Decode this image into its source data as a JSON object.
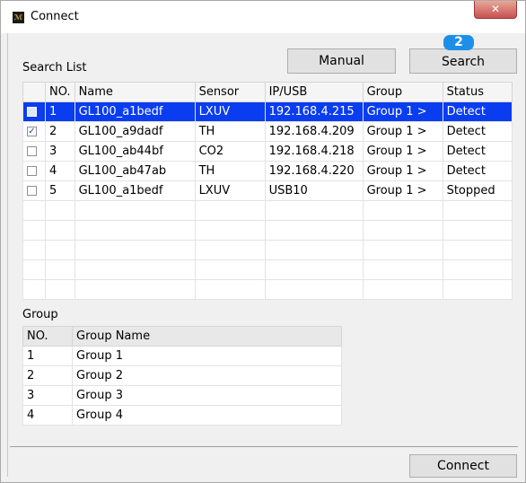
{
  "window": {
    "title": "Connect",
    "icon": "app-logo-icon",
    "close_glyph": "✕"
  },
  "buttons": {
    "manual": "Manual",
    "search": "Search",
    "connect": "Connect"
  },
  "badge": "2",
  "search_list": {
    "label": "Search List",
    "columns": [
      "",
      "NO.",
      "Name",
      "Sensor",
      "IP/USB",
      "Group",
      "Status"
    ],
    "rows": [
      {
        "checked": false,
        "no": "1",
        "name": "GL100_a1bedf",
        "sensor": "LXUV",
        "ip": "192.168.4.215",
        "group": "Group 1 >",
        "status": "Detect",
        "selected": true
      },
      {
        "checked": true,
        "no": "2",
        "name": "GL100_a9dadf",
        "sensor": "TH",
        "ip": "192.168.4.209",
        "group": "Group 1 >",
        "status": "Detect",
        "selected": false
      },
      {
        "checked": false,
        "no": "3",
        "name": "GL100_ab44bf",
        "sensor": "CO2",
        "ip": "192.168.4.218",
        "group": "Group 1 >",
        "status": "Detect",
        "selected": false
      },
      {
        "checked": false,
        "no": "4",
        "name": "GL100_ab47ab",
        "sensor": "TH",
        "ip": "192.168.4.220",
        "group": "Group 1 >",
        "status": "Detect",
        "selected": false
      },
      {
        "checked": false,
        "no": "5",
        "name": "GL100_a1bedf",
        "sensor": "LXUV",
        "ip": "USB10",
        "group": "Group 1 >",
        "status": "Stopped",
        "selected": false
      }
    ]
  },
  "group_list": {
    "label": "Group",
    "columns": [
      "NO.",
      "Group Name"
    ],
    "rows": [
      {
        "no": "1",
        "name": "Group 1"
      },
      {
        "no": "2",
        "name": "Group 2"
      },
      {
        "no": "3",
        "name": "Group 3"
      },
      {
        "no": "4",
        "name": "Group 4"
      }
    ]
  },
  "colors": {
    "selection": "#0a3cf0",
    "badge": "#1d8fe8"
  }
}
